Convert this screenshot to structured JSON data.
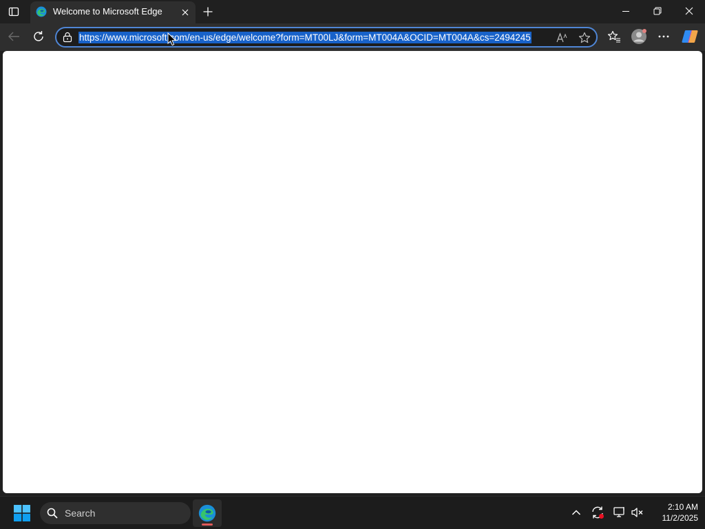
{
  "browser": {
    "tab": {
      "title": "Welcome to Microsoft Edge",
      "favicon": "edge-logo-icon"
    },
    "window_controls": [
      "minimize-icon",
      "restore-icon",
      "close-icon"
    ],
    "address_bar": {
      "url": "https://www.microsoft.com/en-us/edge/welcome?form=MT00LJ&form=MT004A&OCID=MT004A&cs=2494245",
      "selected": true
    },
    "toolbar_icons": [
      "back-icon",
      "refresh-icon",
      "site-info-icon",
      "read-aloud-icon",
      "favorite-star-icon",
      "favorites-icon",
      "profile-icon",
      "more-options-icon",
      "copilot-icon"
    ]
  },
  "taskbar": {
    "search_placeholder": "Search",
    "time": "2:10 AM",
    "date": "11/2/2025",
    "tray_icons": [
      "show-hidden-icons-icon",
      "sync-icon",
      "network-icon",
      "volume-muted-icon"
    ]
  },
  "colors": {
    "titlebar": "#202020",
    "toolbar": "#2e2e2e",
    "address_border": "#4f86d6",
    "selection": "#1862c9",
    "page_background": "#ffffff",
    "taskbar": "#1c1c1c"
  }
}
